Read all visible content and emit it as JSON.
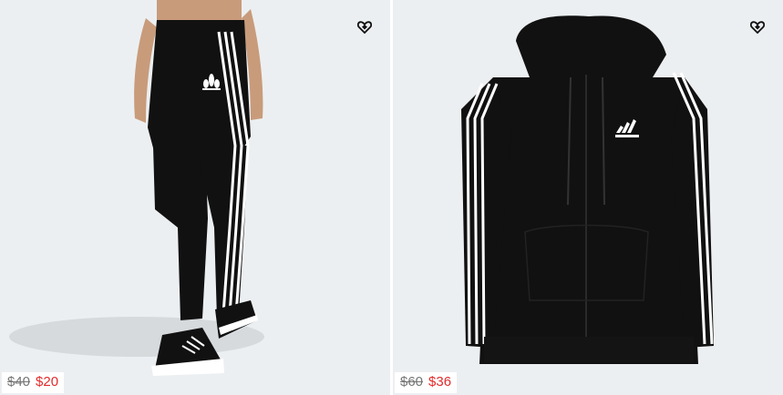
{
  "products": [
    {
      "id_label": "leggings",
      "original_price": "$40",
      "sale_price": "$20",
      "wishlist_icon": "heart-icon",
      "image_icon": "leggings-image"
    },
    {
      "id_label": "hoodie",
      "original_price": "$60",
      "sale_price": "$36",
      "wishlist_icon": "heart-icon",
      "image_icon": "hoodie-image"
    }
  ],
  "colors": {
    "card_bg": "#eceff1",
    "sale_red": "#e32b2b",
    "strike_grey": "#767677",
    "garment_black": "#111111"
  }
}
